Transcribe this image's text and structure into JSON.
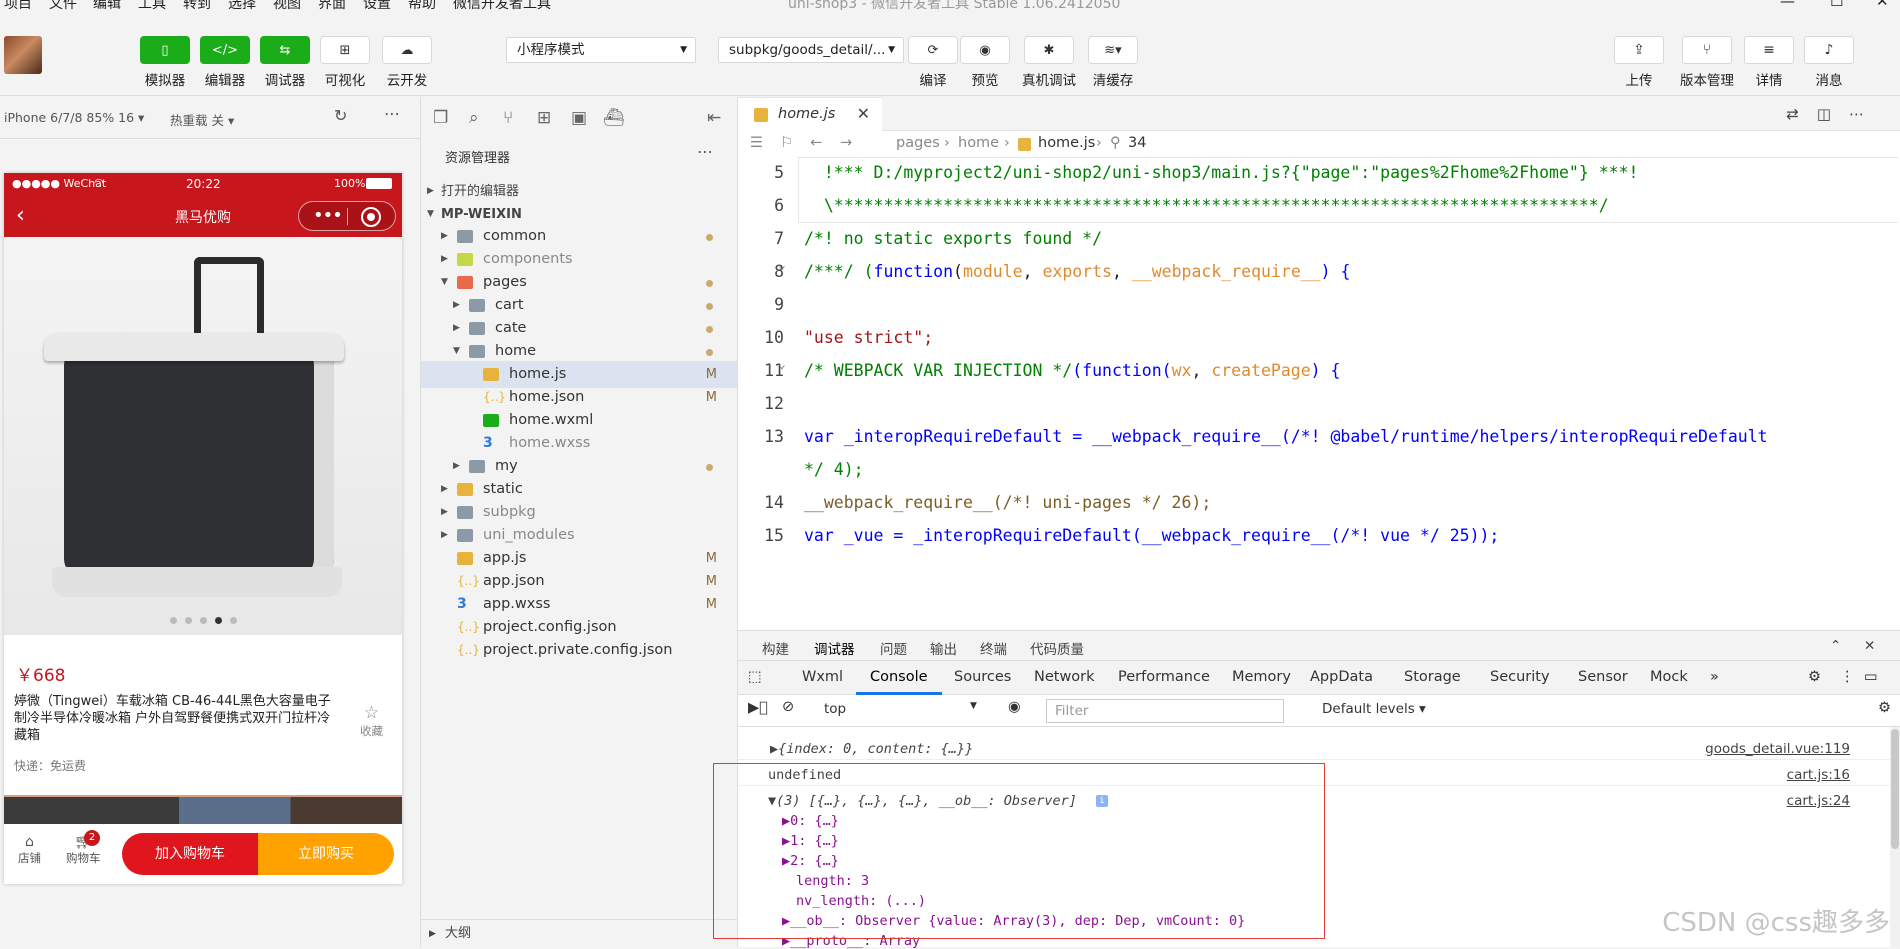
{
  "menubar": {
    "items": [
      "项目",
      "文件",
      "编辑",
      "工具",
      "转到",
      "选择",
      "视图",
      "界面",
      "设置",
      "帮助",
      "微信开发者工具"
    ],
    "window_title": "uni-shop3 - 微信开发者工具 Stable 1.06.2412050"
  },
  "toolbar": {
    "left": [
      {
        "label": "模拟器",
        "icon": "phone-icon"
      },
      {
        "label": "编辑器",
        "icon": "code-icon"
      },
      {
        "label": "调试器",
        "icon": "debug-icon"
      },
      {
        "label": "可视化",
        "icon": "layout-icon"
      },
      {
        "label": "云开发",
        "icon": "cloud-icon"
      }
    ],
    "mode_select": "小程序模式",
    "page_select": "subpkg/goods_detail/...",
    "center": [
      {
        "label": "编译",
        "icon": "refresh-icon"
      },
      {
        "label": "预览",
        "icon": "eye-icon"
      },
      {
        "label": "真机调试",
        "icon": "bug-icon"
      },
      {
        "label": "清缓存",
        "icon": "layers-icon"
      }
    ],
    "right": [
      {
        "label": "上传",
        "icon": "upload-icon"
      },
      {
        "label": "版本管理",
        "icon": "branch-icon"
      },
      {
        "label": "详情",
        "icon": "menu-icon"
      },
      {
        "label": "消息",
        "icon": "bell-icon"
      }
    ]
  },
  "simulator": {
    "device": "iPhone 6/7/8 85% 16 ▾",
    "hot_reload": "热重载 关 ▾",
    "status_left": "●●●●● WeChat",
    "status_time": "20:22",
    "status_battery": "100%",
    "nav_title": "黑马优购",
    "price": "￥668",
    "product_title": "婷微（Tingwei）车载冰箱 CB-46-44L黑色大容量电子制冷半导体冷暖冰箱 户外自驾野餐便携式双开门拉杆冷藏箱",
    "fav_label": "收藏",
    "shipping": "快递：免运费",
    "shop_label": "店铺",
    "cart_label": "购物车",
    "cart_badge": "2",
    "add_cart": "加入购物车",
    "buy_now": "立即购买"
  },
  "explorer": {
    "title": "资源管理器",
    "open_editors": "打开的编辑器",
    "project": "MP-WEIXIN",
    "outline": "大纲",
    "items": [
      {
        "name": "common",
        "status": "dot"
      },
      {
        "name": "components",
        "status": ""
      },
      {
        "name": "pages",
        "status": "dot"
      },
      {
        "name": "cart",
        "status": "dot"
      },
      {
        "name": "cate",
        "status": "dot"
      },
      {
        "name": "home",
        "status": "dot"
      },
      {
        "name": "home.js",
        "status": "M"
      },
      {
        "name": "home.json",
        "status": "M"
      },
      {
        "name": "home.wxml",
        "status": ""
      },
      {
        "name": "home.wxss",
        "status": ""
      },
      {
        "name": "my",
        "status": "dot"
      },
      {
        "name": "static",
        "status": ""
      },
      {
        "name": "subpkg",
        "status": ""
      },
      {
        "name": "uni_modules",
        "status": ""
      },
      {
        "name": "app.js",
        "status": "M"
      },
      {
        "name": "app.json",
        "status": "M"
      },
      {
        "name": "app.wxss",
        "status": "M"
      },
      {
        "name": "project.config.json",
        "status": ""
      },
      {
        "name": "project.private.config.json",
        "status": ""
      }
    ]
  },
  "editor": {
    "tab": "home.js",
    "breadcrumb": [
      "pages",
      "home",
      "home.js",
      "34"
    ],
    "lines": [
      {
        "n": "5",
        "t": "  !*** D:/myproject2/uni-shop2/uni-shop3/main.js?{\"page\":\"pages%2Fhome%2Fhome\"} ***!"
      },
      {
        "n": "6",
        "t": "  \\*****************************************************************************/"
      },
      {
        "n": "7",
        "t": "/*! no static exports found */"
      },
      {
        "n": "8",
        "a": "/***/ (",
        "b": "function",
        "c": "(",
        "d": "module",
        "e": ", ",
        "f": "exports",
        "g": ", ",
        "h": "__webpack_require__",
        "i": ") {"
      },
      {
        "n": "9",
        "t": ""
      },
      {
        "n": "10",
        "t": "\"use strict\";"
      },
      {
        "n": "11",
        "a": "/* WEBPACK VAR INJECTION */",
        "b": "(function(",
        "c": "wx",
        "d": ", ",
        "e": "createPage",
        "f": ") {"
      },
      {
        "n": "12",
        "t": ""
      },
      {
        "n": "13",
        "t": "var _interopRequireDefault = __webpack_require__(/*! @babel/runtime/helpers/interopRequireDefault"
      },
      {
        "n": "",
        "t": "*/ 4);"
      },
      {
        "n": "14",
        "t": "__webpack_require__(/*! uni-pages */ 26);"
      },
      {
        "n": "15",
        "t": "var _vue = _interopRequireDefault(__webpack_require__(/*! vue */ 25));"
      }
    ]
  },
  "console": {
    "panel_tabs": [
      "构建",
      "调试器",
      "问题",
      "输出",
      "终端",
      "代码质量"
    ],
    "devtools_tabs": [
      "Wxml",
      "Console",
      "Sources",
      "Network",
      "Performance",
      "Memory",
      "AppData",
      "Storage",
      "Security",
      "Sensor",
      "Mock",
      "»"
    ],
    "context": "top",
    "filter_placeholder": "Filter",
    "levels": "Default levels ▾",
    "rows": [
      {
        "text": "▶{index: 0, content: {…}}",
        "src": "goods_detail.vue:119"
      },
      {
        "text": "undefined",
        "src": "cart.js:16"
      },
      {
        "text": "▼(3) [{…}, {…}, {…}, __ob__: Observer]",
        "src": "cart.js:24"
      },
      {
        "text": "▶0: {…}",
        "src": ""
      },
      {
        "text": "▶1: {…}",
        "src": ""
      },
      {
        "text": "▶2: {…}",
        "src": ""
      },
      {
        "text": "length: 3",
        "src": ""
      },
      {
        "text": "nv_length: (...)",
        "src": ""
      },
      {
        "text": "▶__ob__: Observer {value: Array(3), dep: Dep, vmCount: 0}",
        "src": ""
      },
      {
        "text": "▶__proto__: Array",
        "src": ""
      }
    ]
  },
  "watermark": "CSDN @css趣多多"
}
